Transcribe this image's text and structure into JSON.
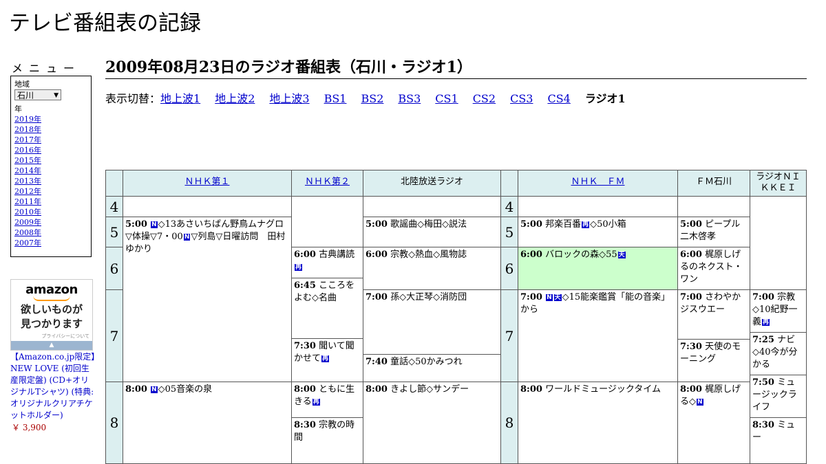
{
  "site": {
    "title": "テレビ番組表の記録"
  },
  "menu": {
    "heading": "メニュー",
    "region_label": "地域",
    "region_value": "石川",
    "year_label": "年",
    "years": [
      "2019年",
      "2018年",
      "2017年",
      "2016年",
      "2015年",
      "2014年",
      "2013年",
      "2012年",
      "2011年",
      "2010年",
      "2009年",
      "2008年",
      "2007年"
    ]
  },
  "ad": {
    "logo": "amazon",
    "tagline_1": "欲しいものが",
    "tagline_2": "見つかります",
    "privacy": "プライバシーについて",
    "product": "【Amazon.co.jp限定】NEW LOVE (初回生産限定盤) (CD+オリジナルTシャツ) (特典: オリジナルクリアチケットホルダー)",
    "price": "￥ 3,900"
  },
  "page": {
    "title": "2009年08月23日のラジオ番組表（石川・ラジオ1）",
    "switch_label": "表示切替：",
    "tabs": [
      "地上波1",
      "地上波2",
      "地上波3",
      "BS1",
      "BS2",
      "BS3",
      "CS1",
      "CS2",
      "CS3",
      "CS4"
    ],
    "current_tab": "ラジオ1"
  },
  "channels": {
    "nhk1": "ＮＨＫ第１",
    "nhk2": "ＮＨＫ第２",
    "hokuriku": "北陸放送ラジオ",
    "nhkfm": "ＮＨＫ　ＦＭ",
    "fmishikawa": "ＦＭ石川",
    "nikkei": "ラジオＮＩＫＫＥＩ"
  },
  "hours": {
    "h4": "4",
    "h5": "5",
    "h6": "6",
    "h7": "7",
    "h8": "8"
  },
  "icons": {
    "news": "N",
    "stereo": "再",
    "weather": "天"
  },
  "programs": {
    "p01": {
      "time": "5:00",
      "a": "◇13あさいちばん野鳥ムナグロ▽体操▽7・00",
      "b": "▽列島▽日曜訪問　田村ゆかり"
    },
    "p02": {
      "time": "8:00",
      "a": "◇05音楽の泉"
    },
    "p03": {
      "time": "6:00",
      "a": "古典講読"
    },
    "p04": {
      "time": "6:45",
      "a": "こころをよむ◇名曲"
    },
    "p05": {
      "time": "7:30",
      "a": "聞いて聞かせて"
    },
    "p06": {
      "time": "8:00",
      "a": "ともに生きる"
    },
    "p07": {
      "time": "8:30",
      "a": "宗教の時間"
    },
    "p08": {
      "time": "5:00",
      "a": "歌謡曲◇梅田◇説法"
    },
    "p09": {
      "time": "6:00",
      "a": "宗教◇熱血◇風物誌"
    },
    "p10": {
      "time": "7:00",
      "a": "孫◇大正琴◇消防団"
    },
    "p11": {
      "time": "7:40",
      "a": "童話◇50かみつれ"
    },
    "p12": {
      "time": "8:00",
      "a": "きよし節◇サンデー"
    },
    "p13": {
      "time": "5:00",
      "a": "邦楽百番",
      "b": "◇50小箱"
    },
    "p14": {
      "time": "6:00",
      "a": "バロックの森◇55"
    },
    "p15": {
      "time": "7:00",
      "a": "◇15能楽鑑賞「能の音楽」から"
    },
    "p16": {
      "time": "8:00",
      "a": "ワールドミュージックタイム"
    },
    "p17": {
      "time": "5:00",
      "a": "ピープル二木啓孝"
    },
    "p18": {
      "time": "6:00",
      "a": "梶原しげるのネクスト・ワン"
    },
    "p19": {
      "time": "7:00",
      "a": "さわやかジスウエー"
    },
    "p20": {
      "time": "7:30",
      "a": "天使のモーニング"
    },
    "p21": {
      "time": "8:00",
      "a": "梶原しげる◇"
    },
    "p22": {
      "time": "7:00",
      "a": "宗教◇10紀野一義"
    },
    "p23": {
      "time": "7:25",
      "a": "ナビ◇40今が分かる"
    },
    "p24": {
      "time": "7:50",
      "a": "ミュージックライフ"
    },
    "p25": {
      "time": "8:30",
      "a": "ミュー"
    }
  }
}
